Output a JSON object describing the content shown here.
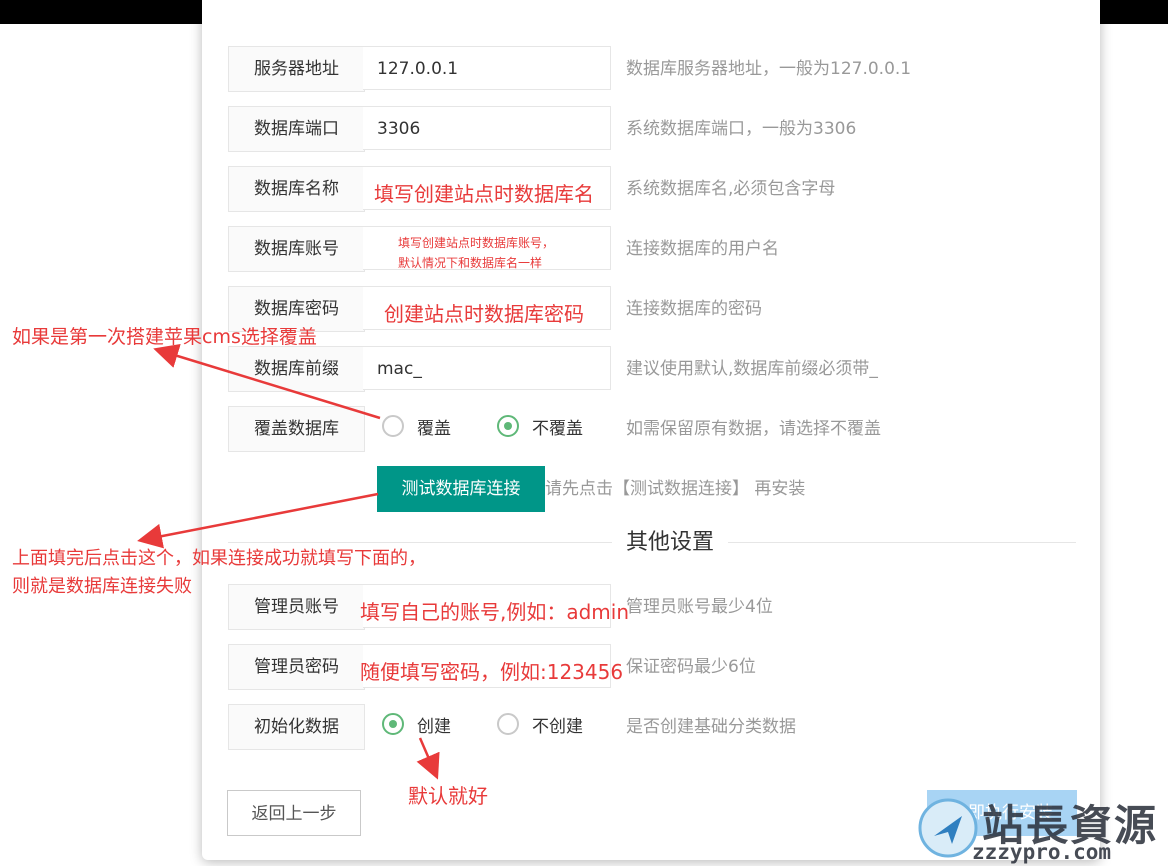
{
  "form": {
    "rows": [
      {
        "label": "服务器地址",
        "value": "127.0.0.1",
        "hint": "数据库服务器地址，一般为127.0.0.1"
      },
      {
        "label": "数据库端口",
        "value": "3306",
        "hint": "系统数据库端口，一般为3306"
      },
      {
        "label": "数据库名称",
        "value": "",
        "hint": "系统数据库名,必须包含字母"
      },
      {
        "label": "数据库账号",
        "value": "",
        "hint": "连接数据库的用户名"
      },
      {
        "label": "数据库密码",
        "value": "",
        "hint": "连接数据库的密码"
      },
      {
        "label": "数据库前缀",
        "value": "mac_",
        "hint": "建议使用默认,数据库前缀必须带_"
      }
    ],
    "cover": {
      "label": "覆盖数据库",
      "option_yes": "覆盖",
      "option_no": "不覆盖",
      "selected": "不覆盖",
      "hint": "如需保留原有数据，请选择不覆盖"
    },
    "test_button": "测试数据库连接",
    "test_hint": "请先点击【测试数据连接】 再安装",
    "section_title": "其他设置",
    "admin_account": {
      "label": "管理员账号",
      "value": "",
      "hint": "管理员账号最少4位"
    },
    "admin_password": {
      "label": "管理员密码",
      "value": "",
      "hint": "保证密码最少6位"
    },
    "init_data": {
      "label": "初始化数据",
      "option_yes": "创建",
      "option_no": "不创建",
      "selected": "创建",
      "hint": "是否创建基础分类数据"
    },
    "back_button": "返回上一步",
    "install_button": "立即执行安装"
  },
  "annotations": {
    "db_name": "填写创建站点时数据库名",
    "db_user_line1": "填写创建站点时数据库账号，",
    "db_user_line2": "默认情况下和数据库名一样",
    "db_password": "创建站点时数据库密码",
    "cover_note": "如果是第一次搭建苹果cms选择覆盖",
    "test_note_line1": "上面填完后点击这个，如果连接成功就填写下面的，",
    "test_note_line2": "则就是数据库连接失败",
    "admin_account_note": "填写自己的账号,例如：admin",
    "admin_password_note": "随便填写密码，例如:123456",
    "init_note": "默认就好"
  },
  "watermark": {
    "title": "站長資源",
    "url": "zzzypro.com"
  },
  "colors": {
    "annotation": "#e83a3a",
    "primary": "#009688",
    "radio_on": "#5fb878",
    "install_bg": "#a8d4f4"
  }
}
